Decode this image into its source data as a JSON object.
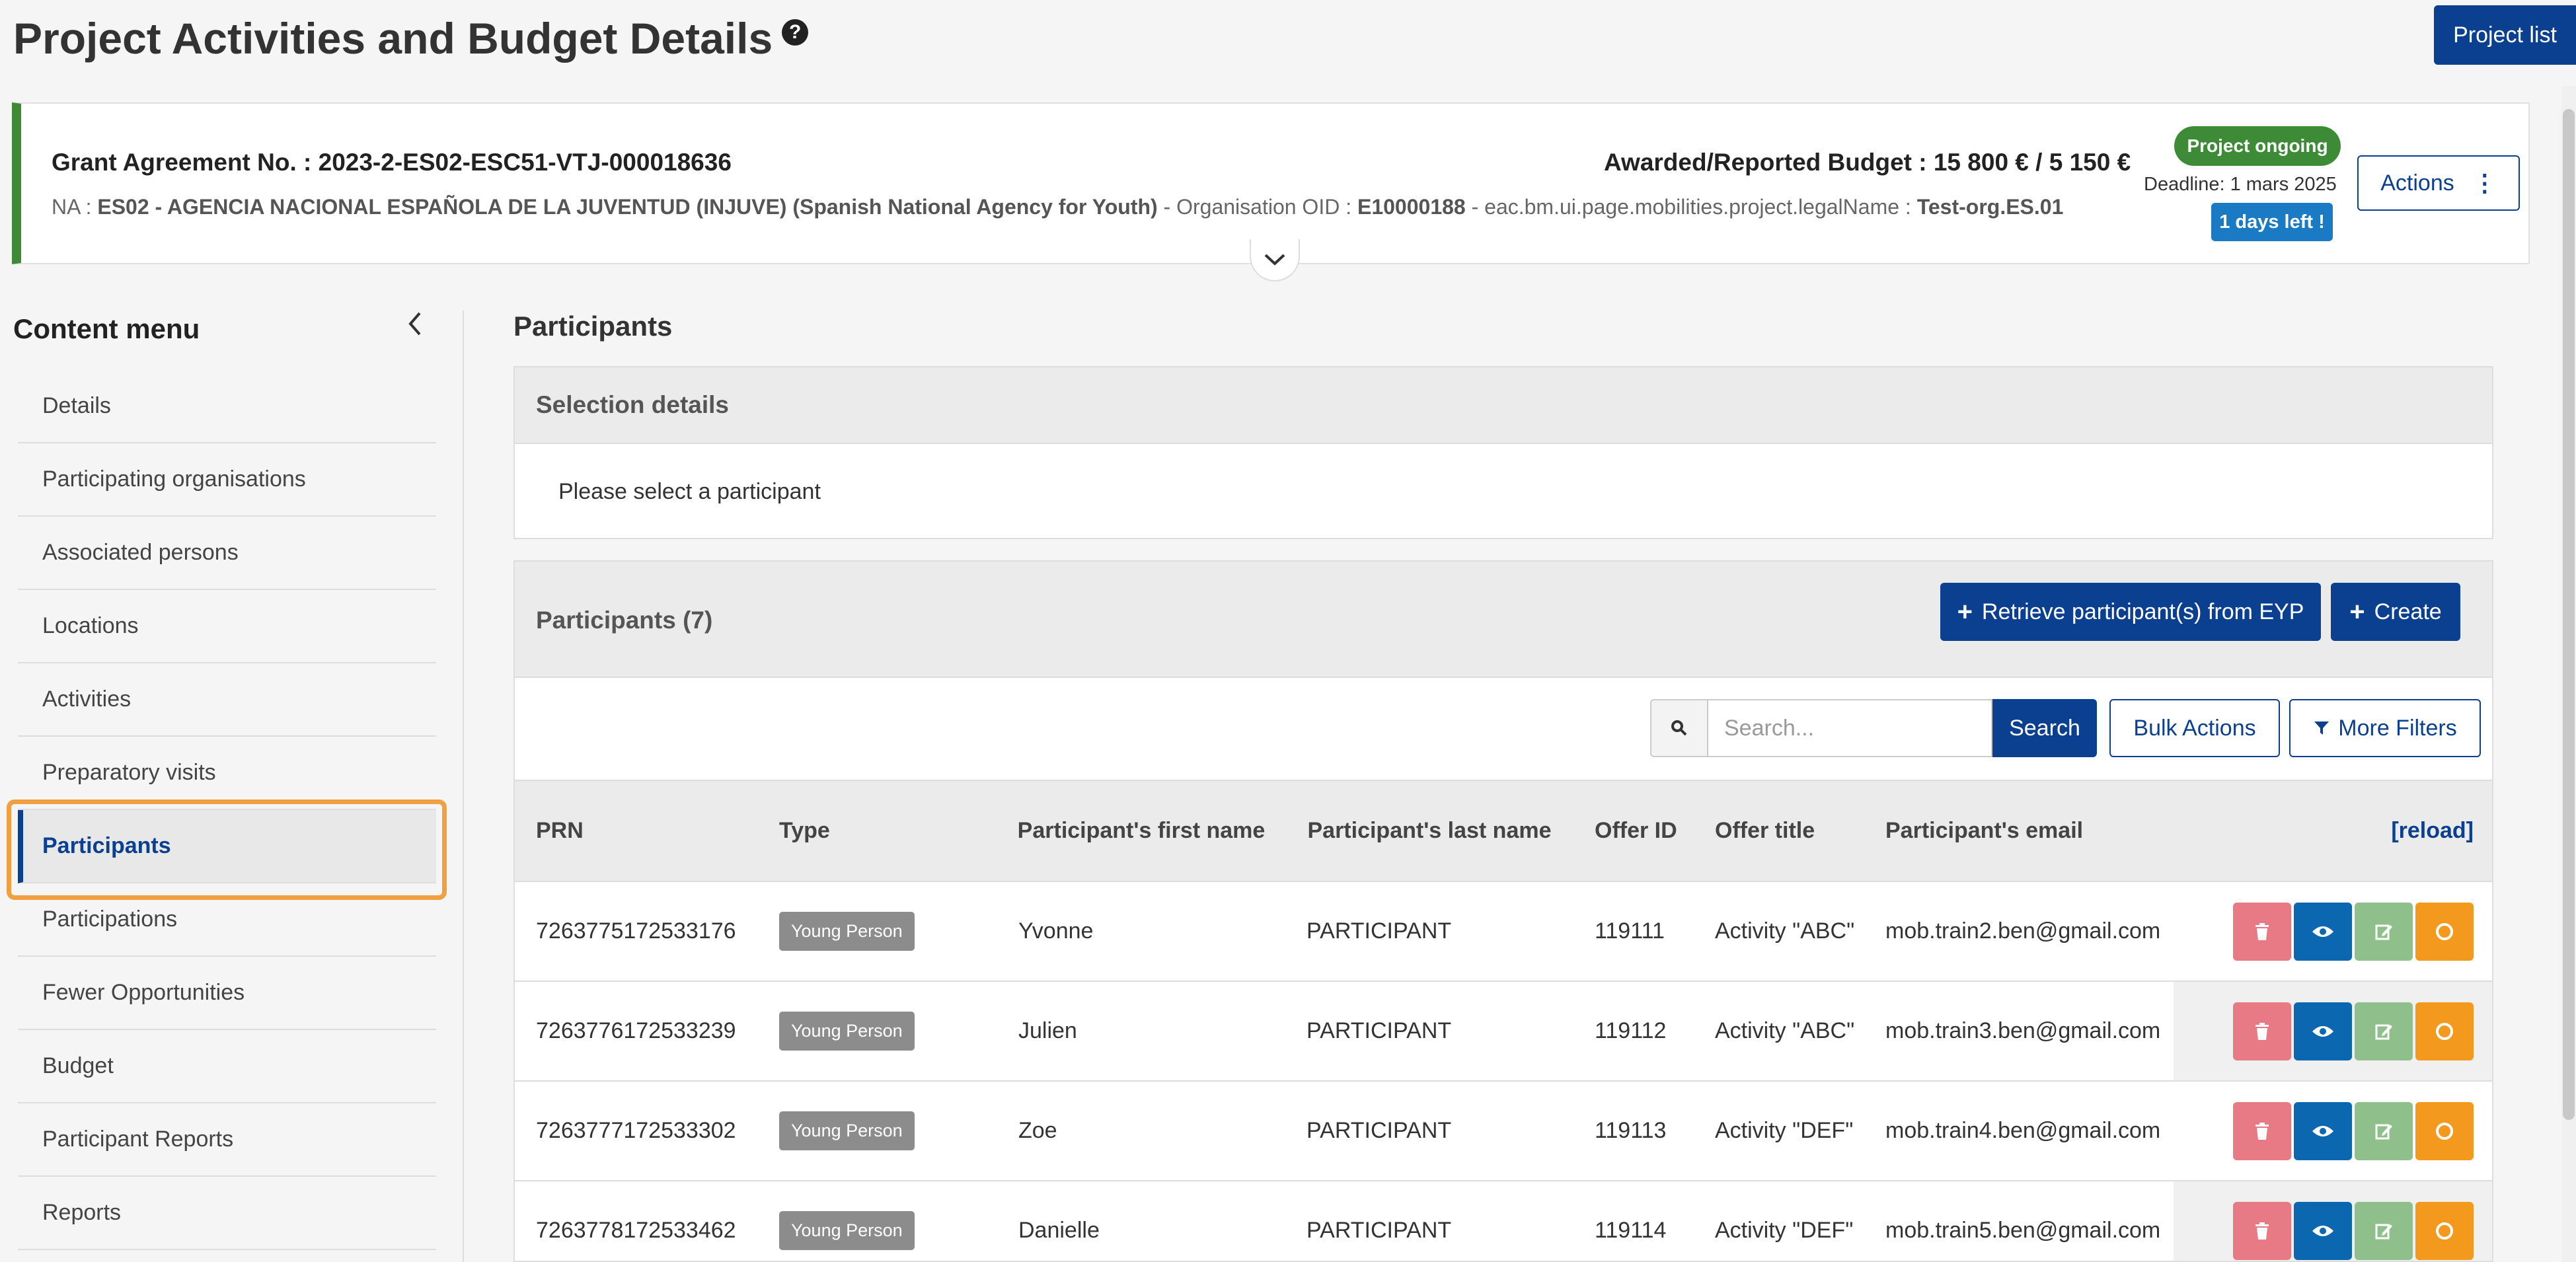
{
  "page": {
    "title": "Project Activities and Budget Details",
    "project_list_label": "Project list"
  },
  "header": {
    "ga_label": "Grant Agreement No. : 2023-2-ES02-ESC51-VTJ-000018636",
    "na_prefix": "NA : ",
    "na_name": "ES02 - AGENCIA NACIONAL ESPAÑOLA DE LA JUVENTUD (INJUVE) (Spanish National Agency for Youth)",
    "oid_prefix": " - Organisation OID : ",
    "oid": "E10000188",
    "legal_prefix": " - eac.bm.ui.page.mobilities.project.legalName : ",
    "legal_name": "Test-org.ES.01",
    "budget": "Awarded/Reported Budget : 15 800 € / 5 150 €",
    "status": "Project ongoing",
    "deadline": "Deadline: 1 mars 2025",
    "days_left": "1 days left !",
    "actions_label": "Actions"
  },
  "sidebar": {
    "title": "Content menu",
    "items": [
      {
        "label": "Details"
      },
      {
        "label": "Participating organisations"
      },
      {
        "label": "Associated persons"
      },
      {
        "label": "Locations"
      },
      {
        "label": "Activities"
      },
      {
        "label": "Preparatory visits"
      },
      {
        "label": "Participants"
      },
      {
        "label": "Participations"
      },
      {
        "label": "Fewer Opportunities"
      },
      {
        "label": "Budget"
      },
      {
        "label": "Participant Reports"
      },
      {
        "label": "Reports"
      }
    ],
    "active_index": 6
  },
  "main": {
    "section_title": "Participants",
    "selection": {
      "title": "Selection details",
      "message": "Please select a participant"
    },
    "participants": {
      "title": "Participants (7)",
      "retrieve_label": "Retrieve participant(s) from EYP",
      "create_label": "Create",
      "search_placeholder": "Search...",
      "search_label": "Search",
      "bulk_label": "Bulk Actions",
      "filters_label": "More Filters",
      "columns": {
        "prn": "PRN",
        "type": "Type",
        "first": "Participant's first name",
        "last": "Participant's last name",
        "offer_id": "Offer ID",
        "offer_title": "Offer title",
        "email": "Participant's email",
        "reload": "[reload]"
      },
      "rows": [
        {
          "prn": "7263775172533176",
          "type": "Young Person",
          "first": "Yvonne",
          "last": "PARTICIPANT",
          "offer_id": "119111",
          "offer_title": "Activity \"ABC\"",
          "email": "mob.train2.ben@gmail.com"
        },
        {
          "prn": "7263776172533239",
          "type": "Young Person",
          "first": "Julien",
          "last": "PARTICIPANT",
          "offer_id": "119112",
          "offer_title": "Activity \"ABC\"",
          "email": "mob.train3.ben@gmail.com"
        },
        {
          "prn": "7263777172533302",
          "type": "Young Person",
          "first": "Zoe",
          "last": "PARTICIPANT",
          "offer_id": "119113",
          "offer_title": "Activity \"DEF\"",
          "email": "mob.train4.ben@gmail.com"
        },
        {
          "prn": "7263778172533462",
          "type": "Young Person",
          "first": "Danielle",
          "last": "PARTICIPANT",
          "offer_id": "119114",
          "offer_title": "Activity \"DEF\"",
          "email": "mob.train5.ben@gmail.com"
        }
      ]
    }
  },
  "colors": {
    "primary": "#0b3f8f",
    "success": "#3d8b37",
    "info": "#1a7bc4",
    "highlight": "#f0a040",
    "delete": "#e87a85",
    "view": "#0b67b0",
    "edit": "#8fbf8a",
    "status": "#f39a1e"
  },
  "icons": {
    "help": "question-circle-icon",
    "collapse": "chevron-left-icon",
    "expand": "chevron-down-icon",
    "search": "magnifier-icon",
    "filter": "funnel-icon",
    "delete": "trash-icon",
    "view": "eye-icon",
    "edit": "pencil-icon",
    "status": "circle-icon"
  }
}
